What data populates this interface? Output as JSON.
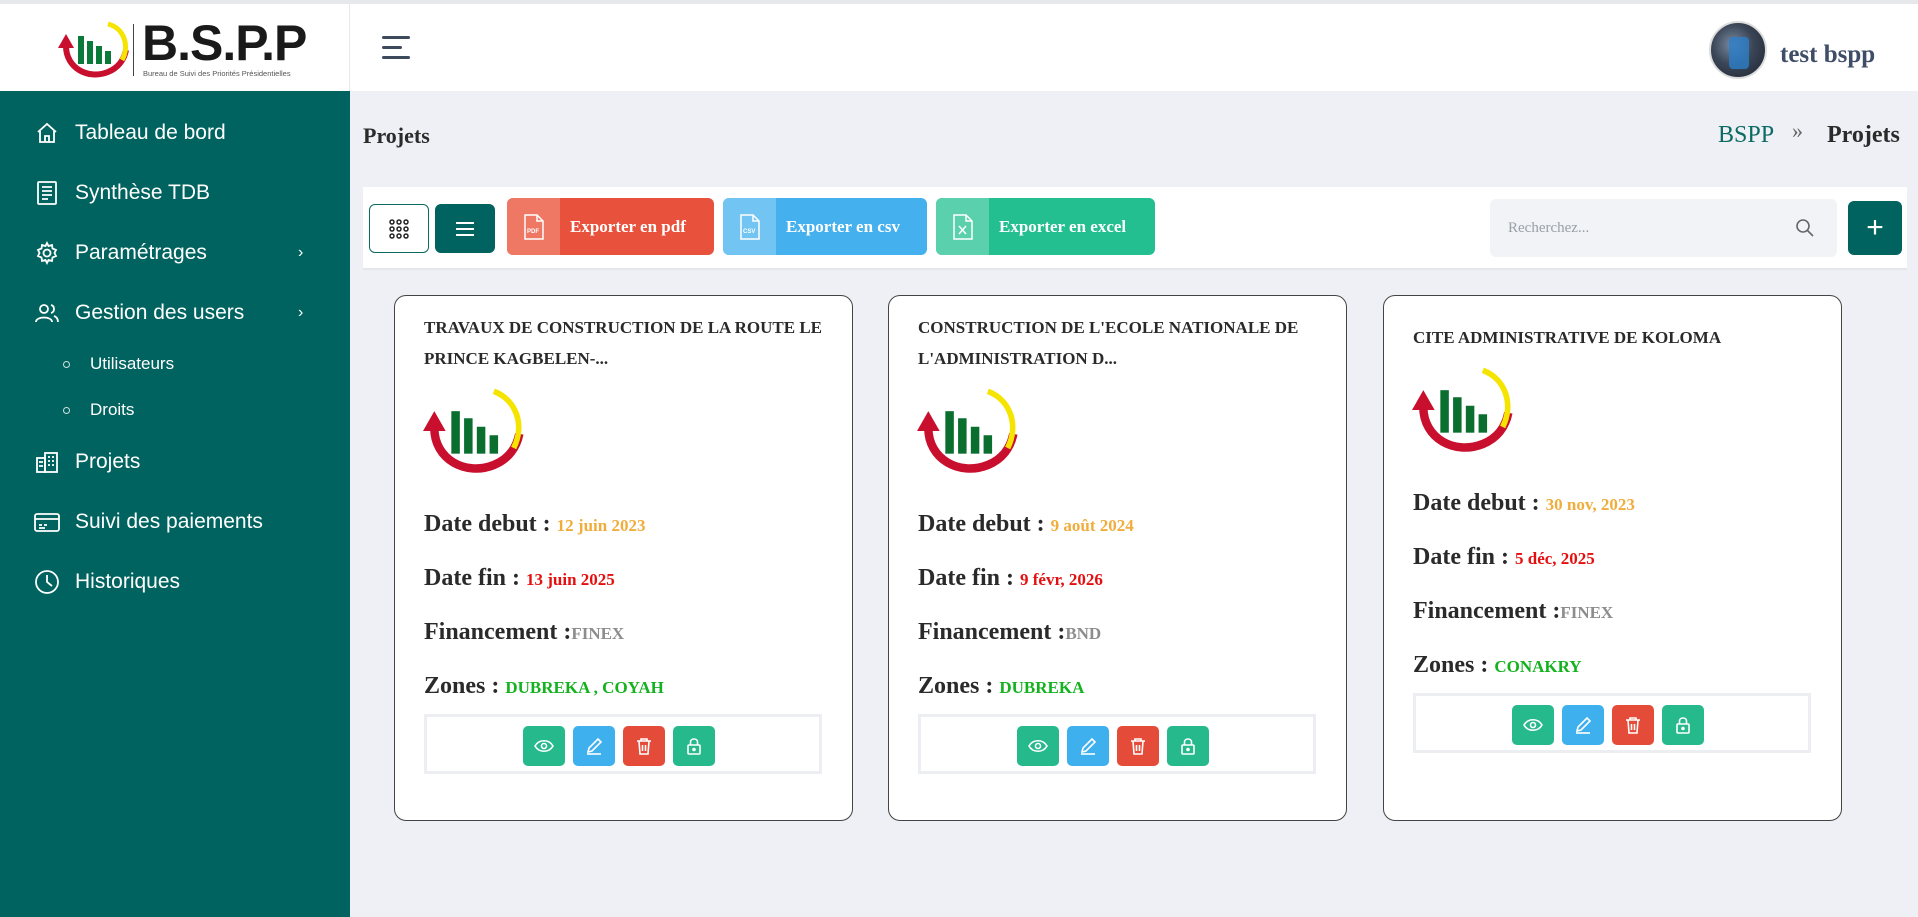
{
  "brand": {
    "name": "B.S.P.P",
    "subtitle": "Bureau de Suivi des Priorités Présidentielles"
  },
  "topbar": {
    "user_name": "test bspp"
  },
  "sidebar": {
    "items": [
      {
        "label": "Tableau de bord",
        "icon": "home-icon"
      },
      {
        "label": "Synthèse TDB",
        "icon": "receipt-icon"
      },
      {
        "label": "Paramétrages",
        "icon": "gear-icon",
        "has_submenu": true
      },
      {
        "label": "Gestion des users",
        "icon": "users-icon",
        "has_submenu": true
      },
      {
        "label": "Projets",
        "icon": "buildings-icon"
      },
      {
        "label": "Suivi des paiements",
        "icon": "payment-card-icon"
      },
      {
        "label": "Historiques",
        "icon": "clock-icon"
      }
    ],
    "subitems": [
      {
        "label": "Utilisateurs"
      },
      {
        "label": "Droits"
      }
    ]
  },
  "page": {
    "title": "Projets",
    "breadcrumb": {
      "home": "BSPP",
      "separator": "»",
      "current": "Projets"
    }
  },
  "toolbar": {
    "export_pdf": "Exporter en pdf",
    "export_csv": "Exporter en csv",
    "export_excel": "Exporter en excel",
    "search_placeholder": "Recherchez...",
    "add_label": "+"
  },
  "labels": {
    "date_debut": "Date debut : ",
    "date_fin": "Date fin : ",
    "financement": "Financement :",
    "zones": "Zones : "
  },
  "projects": [
    {
      "title": "TRAVAUX DE CONSTRUCTION DE LA ROUTE LE PRINCE KAGBELEN-...",
      "date_debut": "12 juin 2023",
      "date_fin": "13 juin 2025",
      "financement": "FINEX",
      "zones": "DUBREKA , COYAH"
    },
    {
      "title": "CONSTRUCTION DE L'ECOLE NATIONALE DE L'ADMINISTRATION D...",
      "date_debut": "9 août 2024",
      "date_fin": "9 févr, 2026",
      "financement": "BND",
      "zones": "DUBREKA"
    },
    {
      "title": "CITE ADMINISTRATIVE DE KOLOMA",
      "date_debut": "30 nov, 2023",
      "date_fin": "5 déc, 2025",
      "financement": "FINEX",
      "zones": "CONAKRY"
    }
  ],
  "colors": {
    "primary": "#00635f",
    "date_start": "#f0ad3c",
    "date_end": "#e50f0f",
    "zones": "#14b21f",
    "pdf": "#e8513b",
    "csv": "#44b0ee",
    "excel": "#24bf90"
  }
}
